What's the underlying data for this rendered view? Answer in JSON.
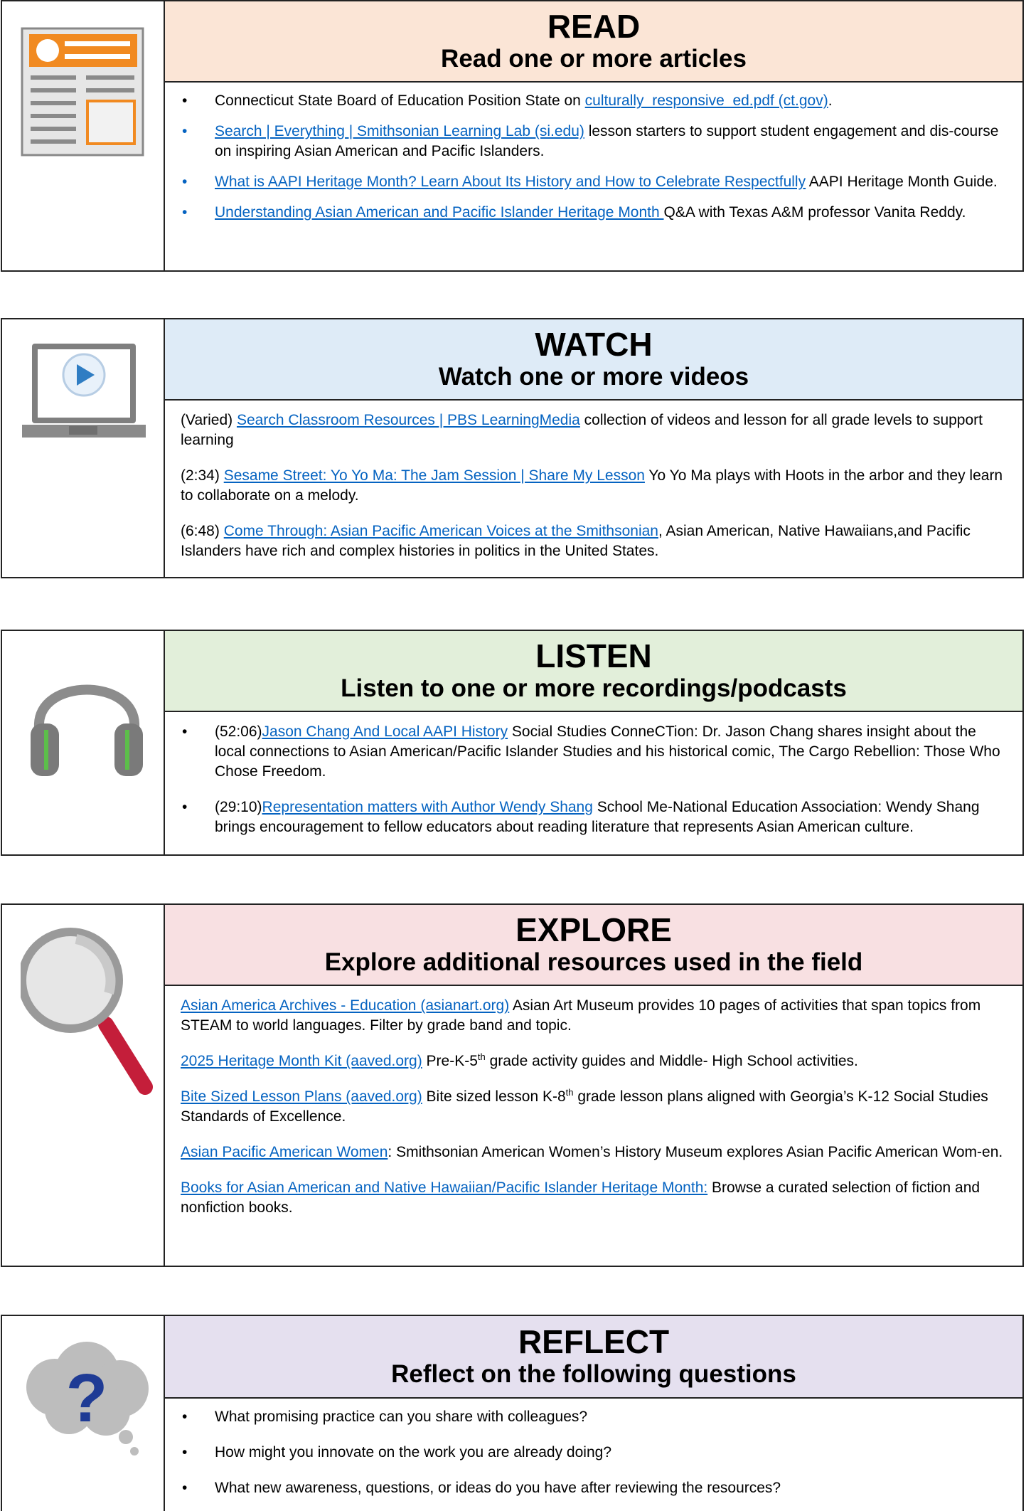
{
  "read": {
    "title": "READ",
    "subtitle": "Read one or more articles",
    "bullet": "•",
    "items": [
      {
        "pre": "Connecticut State Board of Education Position State on ",
        "link": "culturally_responsive_ed.pdf (ct.gov)",
        "post": "."
      },
      {
        "pre": "",
        "link": "Search | Everything | Smithsonian Learning Lab (si.edu)",
        "post": " lesson starters to support student engagement and dis-course on inspiring Asian American and Pacific Islanders."
      },
      {
        "pre": "",
        "link": "What is AAPI Heritage Month? Learn About Its History and How to Celebrate Respectfully",
        "post": " AAPI Heritage Month Guide."
      },
      {
        "pre": "",
        "link": "Understanding Asian American and Pacific Islander Heritage Month ",
        "post": " Q&A with Texas A&M professor Vanita Reddy."
      }
    ],
    "icon": "newspaper-icon"
  },
  "watch": {
    "title": "WATCH",
    "subtitle": "Watch one or more videos",
    "items": [
      {
        "pre": "(Varied) ",
        "link": "Search Classroom Resources | PBS LearningMedia",
        "post": " collection of videos and lesson for all grade levels to support learning"
      },
      {
        "pre": "(2:34) ",
        "link": "Sesame Street: Yo Yo Ma: The Jam Session | Share My Lesson",
        "post": " Yo Yo Ma plays with Hoots in the arbor and they learn to collaborate on a melody."
      },
      {
        "pre": "(6:48) ",
        "link": "Come Through: Asian Pacific American Voices at the Smithsonian",
        "post": ", Asian American, Native Hawaiians,and Pacific Islanders have rich and complex histories in politics in the United States."
      }
    ],
    "icon": "laptop-play-icon"
  },
  "listen": {
    "title": "LISTEN",
    "subtitle": "Listen to one or more recordings/podcasts",
    "items": [
      {
        "pre": "(52:06)",
        "link": "Jason Chang And Local AAPI History",
        "post": " Social Studies ConneCTion: Dr. Jason Chang shares insight about the local connections to Asian American/Pacific Islander Studies and his historical comic, The Cargo Rebellion: Those Who Chose Freedom."
      },
      {
        "pre": "(29:10)",
        "link": "Representation matters with Author Wendy Shang",
        "post": " School Me-National Education Association: Wendy Shang brings encouragement to fellow educators about reading literature that represents Asian American culture."
      }
    ],
    "icon": "headphones-icon"
  },
  "explore": {
    "title": "EXPLORE",
    "subtitle": "Explore additional resources used in the field",
    "items": [
      {
        "link": "Asian America Archives - Education (asianart.org)",
        "post": " Asian Art Museum provides 10 pages of activities that span topics from STEAM to world languages. Filter by grade band and topic."
      },
      {
        "link": "2025 Heritage Month Kit (aaved.org)",
        "post_a": " Pre-K-5",
        "sup": "th",
        "post_b": " grade activity guides and Middle- High School activities."
      },
      {
        "link": "Bite Sized Lesson Plans (aaved.org)",
        "post_a": " Bite sized lesson K-8",
        "sup": "th",
        "post_b": " grade lesson plans aligned with Georgia’s K-12 Social Studies Standards of Excellence."
      },
      {
        "link": "Asian Pacific American Women",
        "post": ": Smithsonian American Women’s History Museum explores Asian Pacific American Wom-en."
      },
      {
        "link": "Books for Asian American and Native Hawaiian/Pacific Islander Heritage Month:",
        "post": " Browse a curated selection of fiction and nonfiction books."
      }
    ],
    "icon": "magnifier-icon"
  },
  "reflect": {
    "title": "REFLECT",
    "subtitle": "Reflect on the following questions",
    "items": [
      "What promising practice can you share with colleagues?",
      "How might you innovate on the work you are already doing?",
      "What new awareness, questions, or ideas do you have after reviewing the resources?"
    ],
    "icon": "question-cloud-icon"
  }
}
